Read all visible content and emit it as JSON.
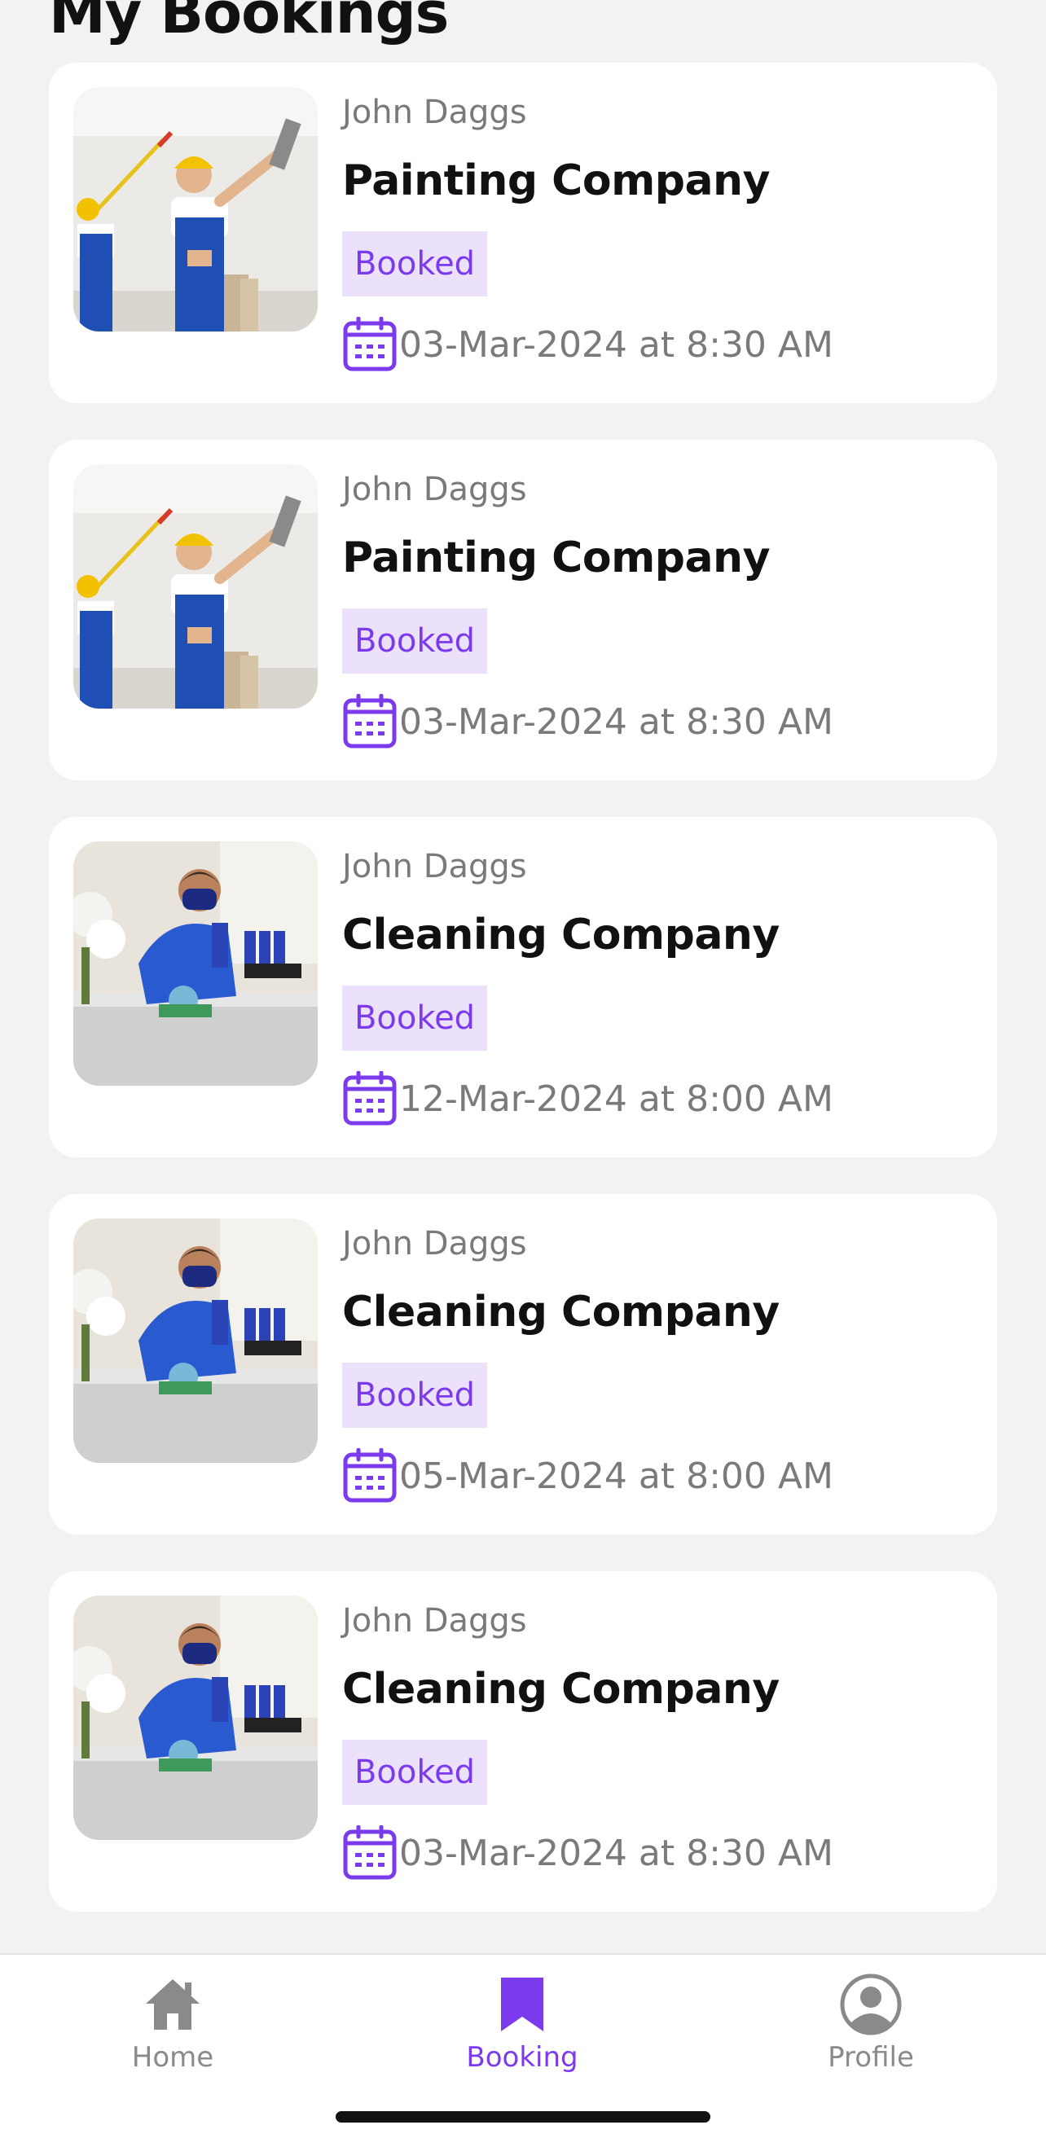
{
  "page_title": "My Bookings",
  "bookings": [
    {
      "provider": "John Daggs",
      "service": "Painting Company",
      "status": "Booked",
      "datetime": "03-Mar-2024 at 8:30 AM",
      "image": "painters-photo"
    },
    {
      "provider": "John Daggs",
      "service": "Painting Company",
      "status": "Booked",
      "datetime": "03-Mar-2024 at 8:30 AM",
      "image": "painters-photo"
    },
    {
      "provider": "John Daggs",
      "service": "Cleaning Company",
      "status": "Booked",
      "datetime": "12-Mar-2024 at 8:00 AM",
      "image": "cleaner-photo"
    },
    {
      "provider": "John Daggs",
      "service": "Cleaning Company",
      "status": "Booked",
      "datetime": "05-Mar-2024 at 8:00 AM",
      "image": "cleaner-photo"
    },
    {
      "provider": "John Daggs",
      "service": "Cleaning Company",
      "status": "Booked",
      "datetime": "03-Mar-2024 at 8:30 AM",
      "image": "cleaner-photo"
    }
  ],
  "tabbar": {
    "home_label": "Home",
    "booking_label": "Booking",
    "profile_label": "Profile",
    "active": "Booking"
  },
  "colors": {
    "accent": "#7c3aed",
    "badge_bg": "#ece1fb",
    "page_bg": "#f2f2f2",
    "inactive_tab": "#8a8a8a"
  },
  "icons": {
    "date": "calendar-icon",
    "home": "home-icon",
    "booking": "bookmark-icon",
    "profile": "user-circle-icon"
  }
}
